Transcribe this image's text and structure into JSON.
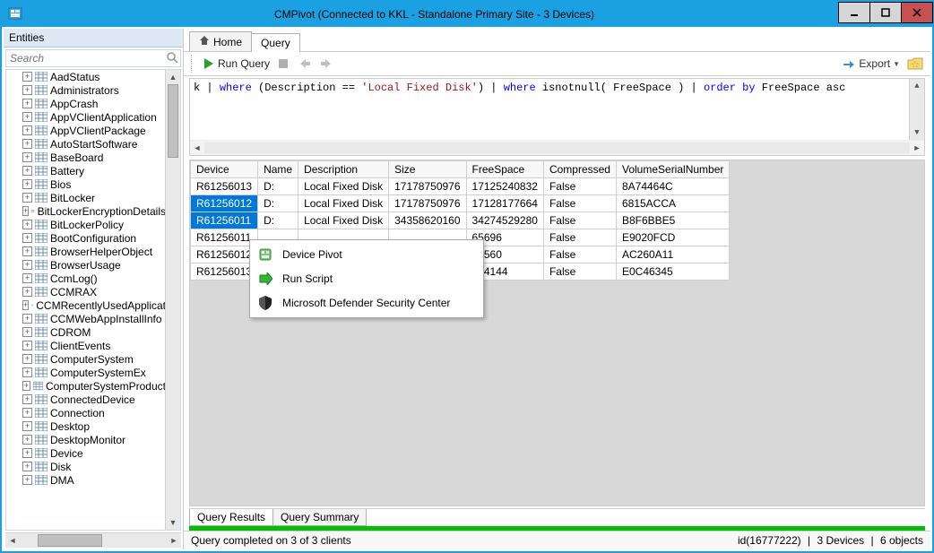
{
  "window": {
    "title": "CMPivot (Connected to KKL - Standalone Primary Site - 3 Devices)"
  },
  "left_panel": {
    "title": "Entities",
    "search_placeholder": "Search"
  },
  "entities": [
    "AadStatus",
    "Administrators",
    "AppCrash",
    "AppVClientApplication",
    "AppVClientPackage",
    "AutoStartSoftware",
    "BaseBoard",
    "Battery",
    "Bios",
    "BitLocker",
    "BitLockerEncryptionDetails",
    "BitLockerPolicy",
    "BootConfiguration",
    "BrowserHelperObject",
    "BrowserUsage",
    "CcmLog()",
    "CCMRAX",
    "CCMRecentlyUsedApplicat",
    "CCMWebAppInstallInfo",
    "CDROM",
    "ClientEvents",
    "ComputerSystem",
    "ComputerSystemEx",
    "ComputerSystemProduct",
    "ConnectedDevice",
    "Connection",
    "Desktop",
    "DesktopMonitor",
    "Device",
    "Disk",
    "DMA"
  ],
  "tabs": {
    "home": "Home",
    "query": "Query"
  },
  "toolbar": {
    "run": "Run Query",
    "export": "Export"
  },
  "query_tokens": [
    "k",
    " | ",
    "where",
    " (Description == ",
    "'Local Fixed Disk'",
    ") | ",
    "where",
    " isnotnull( FreeSpace ) | ",
    "order by",
    " FreeSpace asc"
  ],
  "grid": {
    "headers": [
      "Device",
      "Name",
      "Description",
      "Size",
      "FreeSpace",
      "Compressed",
      "VolumeSerialNumber"
    ],
    "rows": [
      {
        "sel": false,
        "cells": [
          "R61256013",
          "D:",
          "Local Fixed Disk",
          "17178750976",
          "17125240832",
          "False",
          "8A74464C"
        ]
      },
      {
        "sel": true,
        "cells": [
          "R61256012",
          "D:",
          "Local Fixed Disk",
          "17178750976",
          "17128177664",
          "False",
          "6815ACCA"
        ]
      },
      {
        "sel": true,
        "cells": [
          "R61256011",
          "D:",
          "Local Fixed Disk",
          "34358620160",
          "34274529280",
          "False",
          "B8F6BBE5"
        ]
      },
      {
        "sel": false,
        "cells": [
          "R61256011",
          "",
          "",
          "",
          "65696",
          "False",
          "E9020FCD"
        ]
      },
      {
        "sel": false,
        "cells": [
          "R61256012",
          "",
          "",
          "",
          "62560",
          "False",
          "AC260A11"
        ]
      },
      {
        "sel": false,
        "cells": [
          "R61256013",
          "",
          "",
          "",
          "694144",
          "False",
          "E0C46345"
        ]
      }
    ]
  },
  "bottom_tabs": {
    "results": "Query Results",
    "summary": "Query Summary"
  },
  "context_menu": {
    "pivot": "Device Pivot",
    "run_script": "Run Script",
    "defender": "Microsoft Defender Security Center"
  },
  "status": {
    "left": "Query completed on 3 of 3 clients",
    "id": "id(16777222)",
    "devices": "3 Devices",
    "objects": "6 objects"
  }
}
